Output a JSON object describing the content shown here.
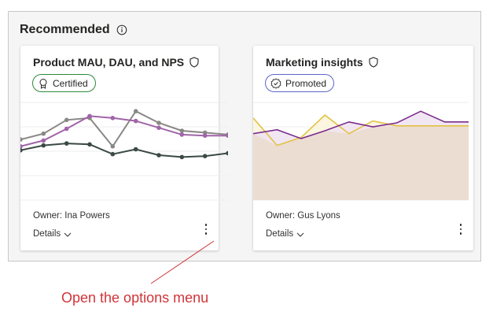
{
  "section": {
    "title": "Recommended",
    "info_icon": "info-icon"
  },
  "cards": [
    {
      "title": "Product MAU, DAU, and NPS",
      "badge": "Certified",
      "badge_icon": "ribbon-icon",
      "owner": "Owner: Ina Powers",
      "details_label": "Details",
      "chart_data": {
        "type": "line",
        "x": [
          0,
          1,
          2,
          3,
          4,
          5,
          6,
          7,
          8,
          9
        ],
        "ylim": [
          0,
          100
        ],
        "grid": true,
        "series": [
          {
            "color": "#8a8886",
            "values": [
              62,
              68,
              82,
              84,
              55,
              91,
              79,
              71,
              69,
              67
            ]
          },
          {
            "color": "#a064a8",
            "values": [
              55,
              61,
              73,
              86,
              84,
              81,
              74,
              67,
              66,
              66
            ]
          },
          {
            "color": "#3b4a47",
            "values": [
              51,
              56,
              58,
              57,
              47,
              52,
              46,
              44,
              45,
              48
            ]
          }
        ]
      }
    },
    {
      "title": "Marketing insights",
      "badge": "Promoted",
      "badge_icon": "check-badge-icon",
      "owner": "Owner: Gus Lyons",
      "details_label": "Details",
      "chart_data": {
        "type": "area",
        "x": [
          0,
          1,
          2,
          3,
          4,
          5,
          6,
          7,
          8,
          9
        ],
        "ylim": [
          0,
          100
        ],
        "grid": true,
        "series": [
          {
            "color": "#e1c240",
            "fill": "#fbf5db",
            "values": [
              84,
              56,
              64,
              87,
              68,
              81,
              76,
              76,
              76,
              76
            ]
          },
          {
            "color": "#7b2c8c",
            "fill": "#efe3f1",
            "values": [
              68,
              72,
              63,
              71,
              80,
              75,
              79,
              91,
              80,
              80
            ]
          }
        ]
      }
    }
  ],
  "annotation": {
    "text": "Open the options menu",
    "color": "#d13438"
  }
}
